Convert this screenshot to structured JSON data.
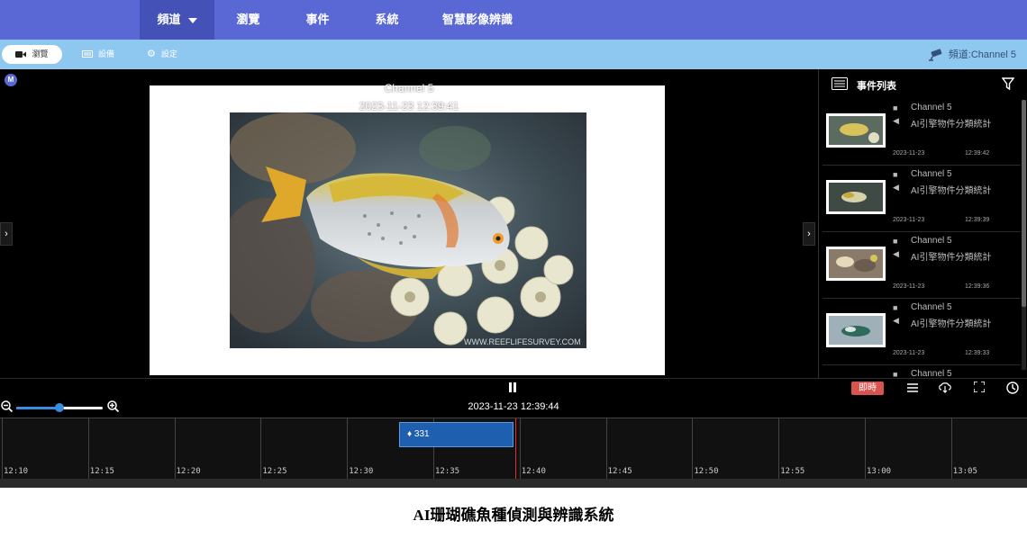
{
  "nav": {
    "items": [
      {
        "label": "頻道",
        "active": true
      },
      {
        "label": "瀏覽"
      },
      {
        "label": "事件"
      },
      {
        "label": "系統"
      },
      {
        "label": "智慧影像辨識"
      }
    ]
  },
  "subbar": {
    "buttons": [
      {
        "label": "瀏覽",
        "icon": "video-camera-icon",
        "active": true
      },
      {
        "label": "設備",
        "icon": "device-icon"
      },
      {
        "label": "設定",
        "icon": "gear-icon"
      }
    ],
    "channel_label": "頻道:Channel 5"
  },
  "viewer": {
    "badge": "M",
    "channel": "Channel 5",
    "timestamp": "2023-11-23 12:39:41",
    "watermark": "WWW.REEFLIFESURVEY.COM"
  },
  "events": {
    "title": "事件列表",
    "items": [
      {
        "channel": "Channel 5",
        "type": "AI引擎物件分類統計",
        "date": "2023-11-23",
        "time": "12:39:42"
      },
      {
        "channel": "Channel 5",
        "type": "AI引擎物件分類統計",
        "date": "2023-11-23",
        "time": "12:39:39"
      },
      {
        "channel": "Channel 5",
        "type": "AI引擎物件分類統計",
        "date": "2023-11-23",
        "time": "12:39:36"
      },
      {
        "channel": "Channel 5",
        "type": "AI引擎物件分類統計",
        "date": "2023-11-23",
        "time": "12:39:33"
      },
      {
        "channel": "Channel 5",
        "type": "",
        "date": "",
        "time": ""
      }
    ]
  },
  "controls": {
    "live_label": "即時"
  },
  "timeline": {
    "current": "2023-11-23 12:39:44",
    "zoom_level": 0.5,
    "labels": [
      "12:10",
      "12:15",
      "12:20",
      "12:25",
      "12:30",
      "12:35",
      "12:40",
      "12:45",
      "12:50",
      "12:55",
      "13:00",
      "13:05"
    ],
    "block_label": "331"
  },
  "caption": "AI珊瑚礁魚種偵測與辨識系統",
  "colors": {
    "nav": "#5a68d6",
    "subbar": "#8ec8f0",
    "live": "#d9534f",
    "block": "#1f5fb0"
  }
}
